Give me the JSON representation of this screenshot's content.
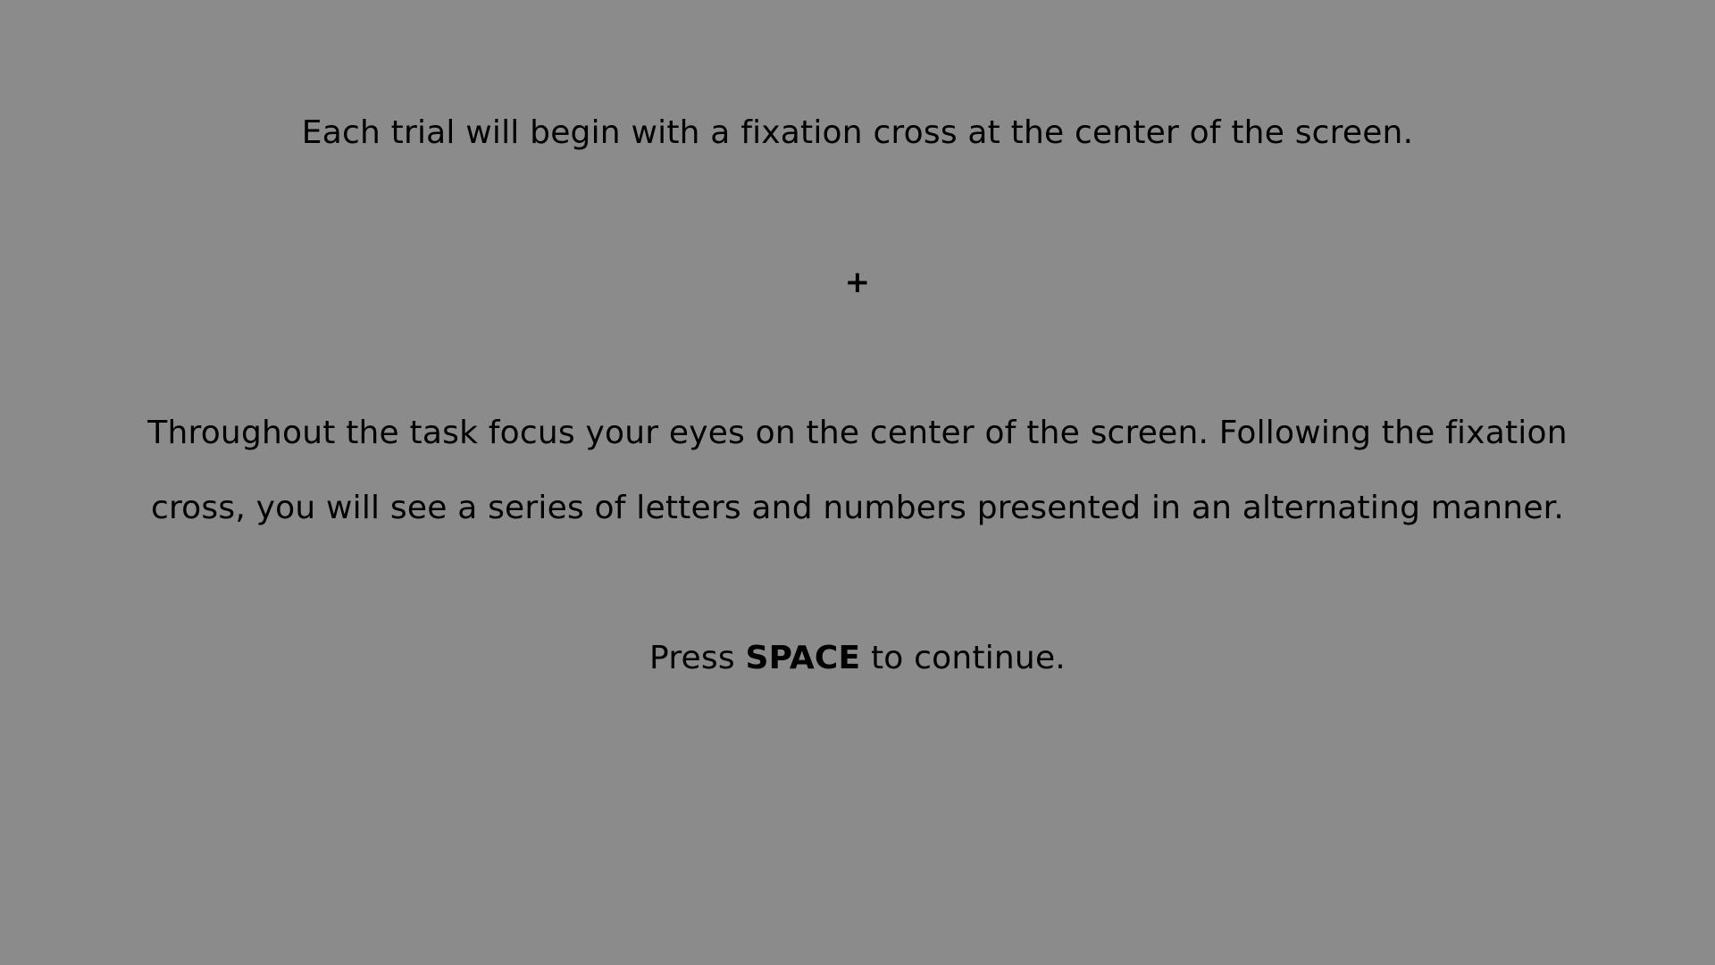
{
  "instructions": {
    "intro": "Each trial will begin with a fixation cross at the center of the screen.",
    "fixation_symbol": "+",
    "body_line_1": "Throughout the task focus your eyes on the center of the screen. Following the fixation",
    "body_line_2": "cross, you will see a series of letters and numbers presented in an alternating manner.",
    "continue_prefix": "Press ",
    "continue_key": "SPACE",
    "continue_suffix": " to continue."
  },
  "colors": {
    "background": "#8b8b8b",
    "text": "#000000"
  }
}
